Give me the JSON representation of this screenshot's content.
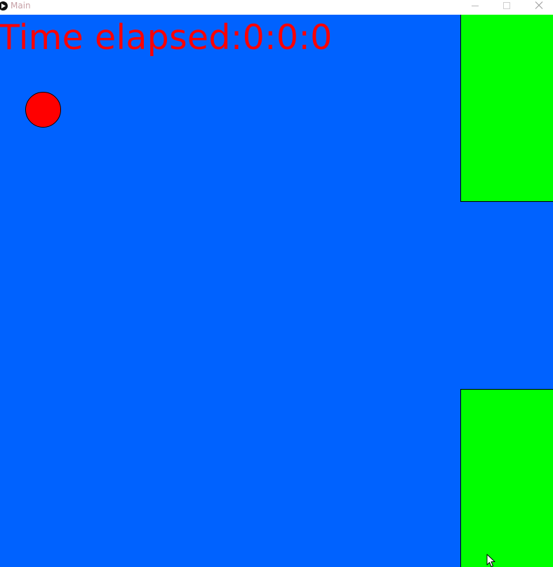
{
  "window": {
    "title": "Main",
    "controls": {
      "minimize_icon": "minimize-icon",
      "maximize_icon": "maximize-icon",
      "close_icon": "close-icon"
    }
  },
  "game": {
    "timer_text": "Time elapsed:0:0:0",
    "colors": {
      "sky": "#0062ff",
      "pipe": "#00ff00",
      "ball": "#ff0000",
      "timer_text": "#ff0000",
      "outline": "#000000"
    }
  }
}
